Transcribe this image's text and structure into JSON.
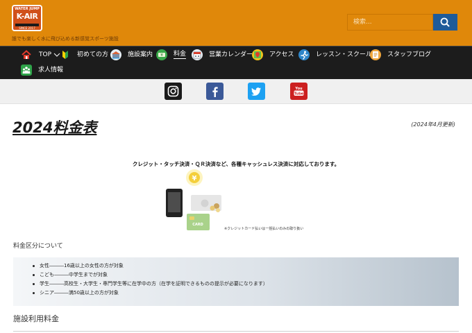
{
  "header": {
    "logo": {
      "top": "WATER JUMP",
      "main": "K-AIR",
      "bottom": "SINCE 2017"
    },
    "tagline": "誰でも楽しく水に飛び込める新感覚スポーツ施設",
    "search": {
      "placeholder": "検索...",
      "icon": "search-icon"
    },
    "colors": {
      "header_bg": "#e0880a",
      "nav_bg": "#1c1c1c",
      "search_button": "#1f5b99"
    }
  },
  "nav": {
    "home_icon": "home-icon",
    "items": [
      {
        "label": "TOP",
        "icon": "chevron-down-icon"
      },
      {
        "label": "初めての方",
        "icon": "beginner-mark-icon"
      },
      {
        "label": "施設案内",
        "icon": "facility-icon"
      },
      {
        "label": "料金",
        "icon": "yen-icon",
        "active": true
      },
      {
        "label": "営業カレンダー",
        "icon": "calendar-icon"
      },
      {
        "label": "アクセス",
        "icon": "map-pin-icon"
      },
      {
        "label": "レッスン・スクール",
        "icon": "runner-icon"
      },
      {
        "label": "スタッフブログ",
        "icon": "blog-icon"
      },
      {
        "label": "求人情報",
        "icon": "group-icon"
      }
    ]
  },
  "social": [
    {
      "name": "Instagram",
      "icon": "instagram-icon",
      "color": "#1a1a1a"
    },
    {
      "name": "Facebook",
      "icon": "facebook-icon",
      "color": "#3b5998"
    },
    {
      "name": "Twitter",
      "icon": "twitter-icon",
      "color": "#1da1f2"
    },
    {
      "name": "YouTube",
      "icon": "youtube-icon",
      "color": "#cc1f1f"
    }
  ],
  "main": {
    "title": "2024料金表",
    "updated": "(2024年4月更新)",
    "payment_note": "クレジット・タッチ決済・ＱＲ決済など、各種キャッシュレス決済に対応しております。",
    "illustration": {
      "symbol": "¥",
      "card_text": "CARD",
      "caption": "※クレジットカード払いは一括払いのみの取り扱い"
    },
    "category_heading": "料金区分について",
    "categories": [
      "女性―――16歳以上の女性の方が対象",
      "こども―――中学生までが対象",
      "学生―――高校生・大学生・専門学生等に在学中の方（在学を証明できるものの提示が必要になります）",
      "シニア―――満50歳以上の方が対象"
    ],
    "usage_heading": "施設利用料金"
  }
}
